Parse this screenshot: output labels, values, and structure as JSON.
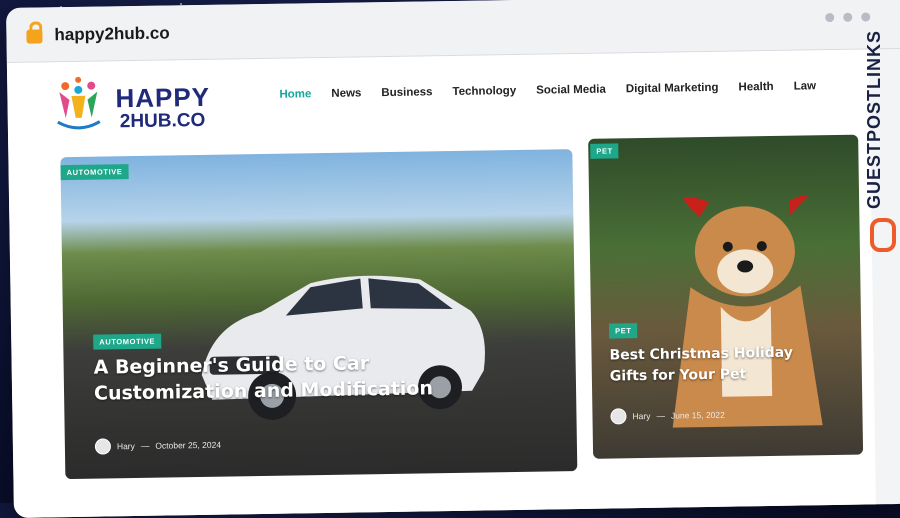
{
  "browser": {
    "url": "happy2hub.co"
  },
  "logo": {
    "line1": "HAPPY",
    "line2": "2HUB.CO"
  },
  "nav": [
    "Home",
    "News",
    "Business",
    "Technology",
    "Social Media",
    "Digital Marketing",
    "Health",
    "Law"
  ],
  "featured": {
    "category_top": "AUTOMOTIVE",
    "category": "AUTOMOTIVE",
    "title": "A Beginner's Guide to Car Customization and Modification",
    "author": "Hary",
    "date": "October 25, 2024"
  },
  "side_post": {
    "category_top": "PET",
    "category": "PET",
    "title": "Best Christmas Holiday Gifts for Your Pet",
    "author": "Hary",
    "date": "June 15, 2022"
  },
  "side_brand": "GUESTPOSTLINKS",
  "colors": {
    "accent": "#12a89a",
    "badge": "#1fa78a",
    "logo_blue": "#1f2a7a",
    "brand_orange": "#ef5a2a"
  }
}
